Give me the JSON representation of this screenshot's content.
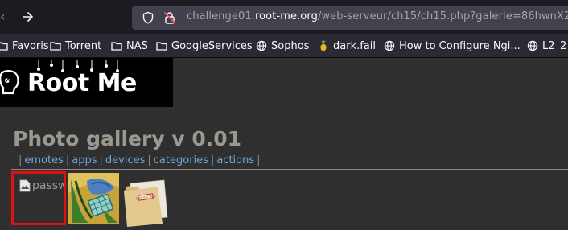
{
  "browser": {
    "url_prefix": "challenge01.",
    "url_host": "root-me.org",
    "url_path": "/web-serveur/ch15/ch15.php?galerie=86hwnX2r",
    "bookmarks": [
      {
        "label": "Favoris",
        "icon": "folder-icon"
      },
      {
        "label": "Torrent",
        "icon": "folder-icon"
      },
      {
        "label": "NAS",
        "icon": "folder-icon"
      },
      {
        "label": "GoogleServices",
        "icon": "folder-icon"
      },
      {
        "label": "Sophos",
        "icon": "globe-icon"
      },
      {
        "label": "dark.fail",
        "icon": "pineapple-icon"
      },
      {
        "label": "How to Configure Ngi...",
        "icon": "globe-icon"
      },
      {
        "label": "L2_2_",
        "icon": "globe-icon"
      }
    ]
  },
  "site": {
    "logo_text": "Root Me"
  },
  "gallery": {
    "title": "Photo gallery v 0.01",
    "menu": [
      "emotes",
      "apps",
      "devices",
      "categories",
      "actions"
    ],
    "broken_image_alt": "passw"
  },
  "colors": {
    "link": "#6fa8dc",
    "highlight_border": "#e41010",
    "title": "#9a9890"
  }
}
